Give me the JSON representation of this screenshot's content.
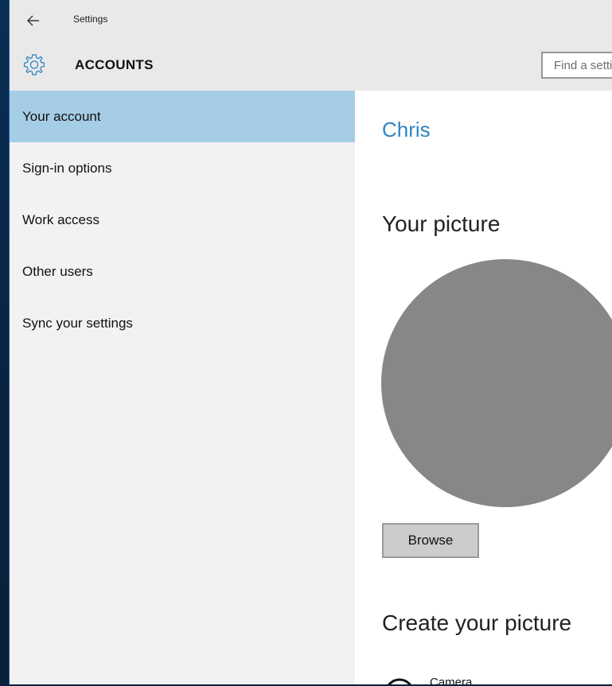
{
  "window": {
    "title": "Settings"
  },
  "header": {
    "section": "ACCOUNTS",
    "search_placeholder": "Find a setting"
  },
  "sidebar": {
    "items": [
      {
        "label": "Your account",
        "selected": true
      },
      {
        "label": "Sign-in options",
        "selected": false
      },
      {
        "label": "Work access",
        "selected": false
      },
      {
        "label": "Other users",
        "selected": false
      },
      {
        "label": "Sync your settings",
        "selected": false
      }
    ]
  },
  "main": {
    "user_name": "Chris",
    "your_picture_heading": "Your picture",
    "browse_label": "Browse",
    "create_picture_heading": "Create your picture",
    "camera_label": "Camera"
  },
  "colors": {
    "accent": "#2f86c3",
    "selected_nav": "#a6cde6",
    "avatar": "#878787",
    "chrome": "#e9e9e9"
  },
  "icons": {
    "back": "back-arrow-icon",
    "section": "gear-icon",
    "camera": "camera-icon"
  }
}
